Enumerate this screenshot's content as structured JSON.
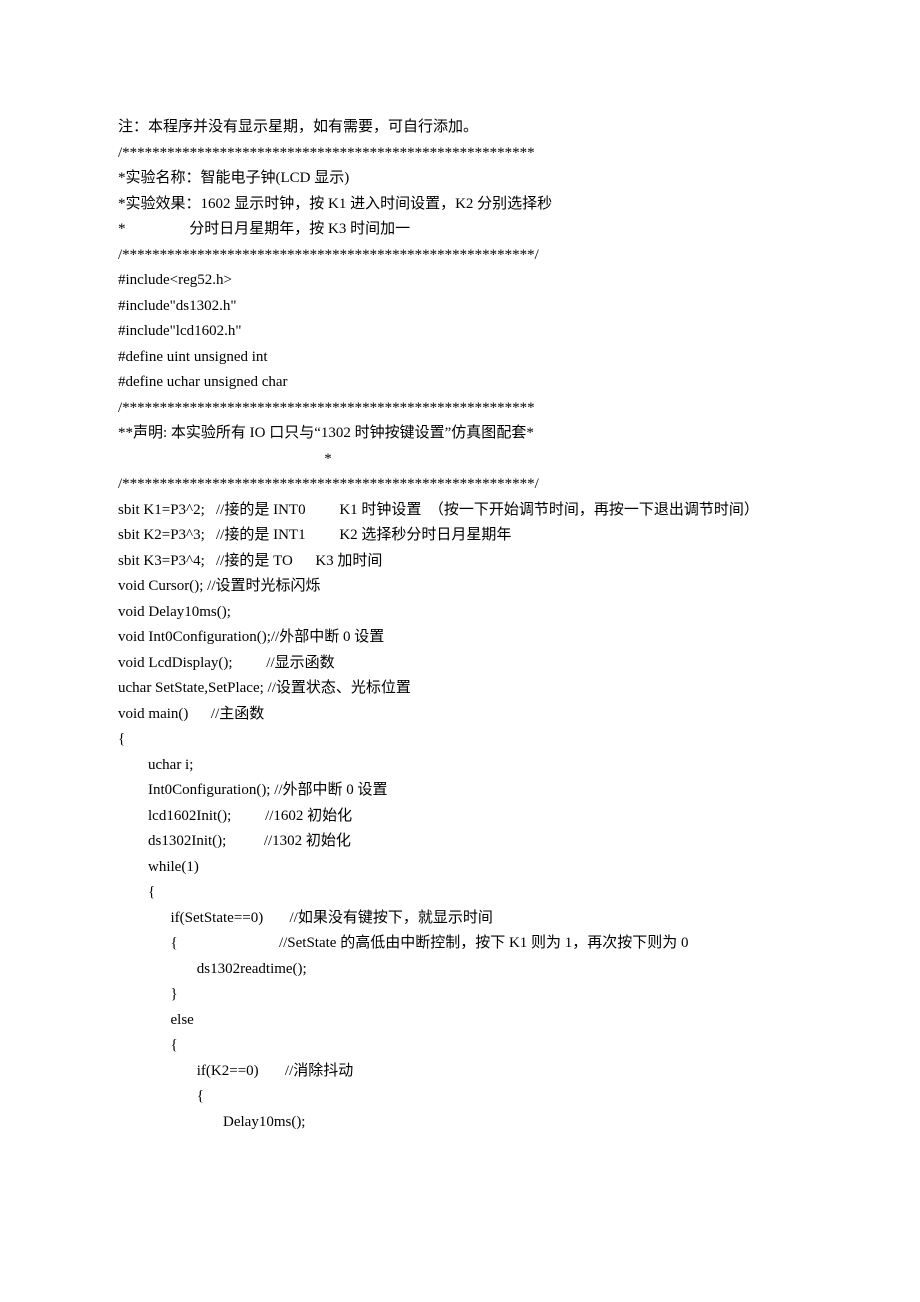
{
  "lines": [
    "注：本程序并没有显示星期，如有需要，可自行添加。",
    "/*******************************************************",
    "*实验名称：智能电子钟(LCD 显示)",
    "*实验效果：1602 显示时钟，按 K1 进入时间设置，K2 分别选择秒",
    "*                 分时日月星期年，按 K3 时间加一",
    "/*******************************************************/",
    "#include<reg52.h>",
    "#include\"ds1302.h\"",
    "#include\"lcd1602.h\"",
    "",
    "#define uint unsigned int",
    "#define uchar unsigned char",
    "/*******************************************************",
    "**声明: 本实验所有 IO 口只与“1302 时钟按键设置”仿真图配套*",
    "                                                       *",
    "/*******************************************************/",
    "sbit K1=P3^2;   //接的是 INT0         K1 时钟设置  （按一下开始调节时间，再按一下退出调节时间）",
    "sbit K2=P3^3;   //接的是 INT1         K2 选择秒分时日月星期年",
    "sbit K3=P3^4;   //接的是 TO      K3 加时间",
    "",
    "void Cursor(); //设置时光标闪烁",
    "void Delay10ms();",
    "void Int0Configuration();//外部中断 0 设置",
    "void LcdDisplay();         //显示函数",
    "uchar SetState,SetPlace; //设置状态、光标位置",
    "",
    "void main()      //主函数",
    "{",
    "        uchar i;",
    "        Int0Configuration(); //外部中断 0 设置",
    "        lcd1602Init();         //1602 初始化",
    "        ds1302Init();          //1302 初始化",
    "        while(1)",
    "        {",
    "              if(SetState==0)       //如果没有键按下，就显示时间",
    "              {                           //SetState 的高低由中断控制，按下 K1 则为 1，再次按下则为 0",
    "                     ds1302readtime();",
    "              }",
    "              else",
    "              {",
    "                     if(K2==0)       //消除抖动",
    "                     {",
    "                            Delay10ms();"
  ]
}
